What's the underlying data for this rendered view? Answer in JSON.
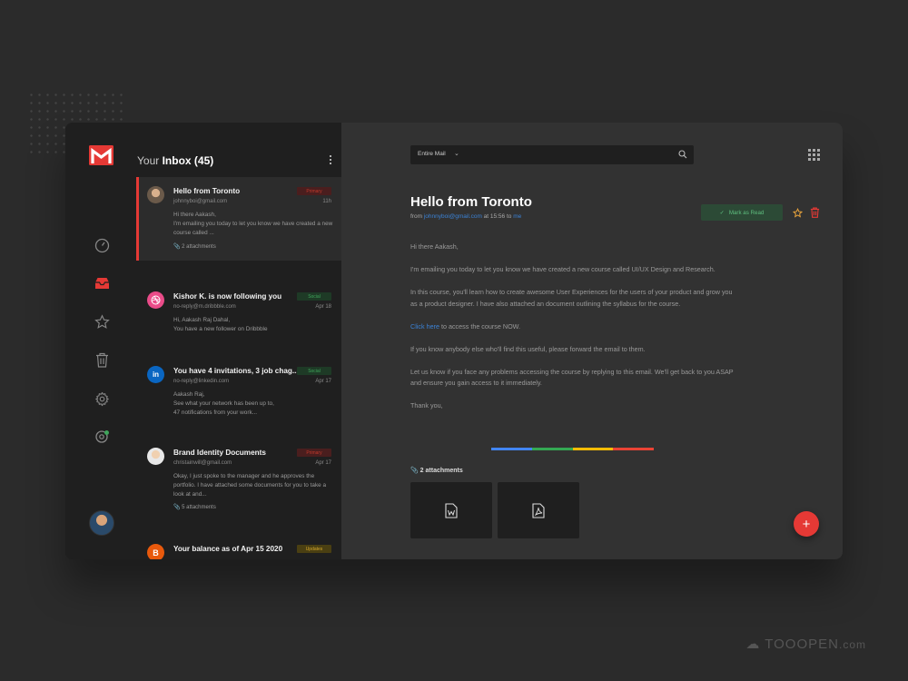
{
  "colors": {
    "accent_red": "#e53935",
    "link_blue": "#3b82d6",
    "success_green": "#5fbf7f"
  },
  "inbox": {
    "title_prefix": "Your",
    "title_main": "Inbox (45)",
    "mails": [
      {
        "subject": "Hello from Toronto",
        "from": "johnnyboi@gmail.com",
        "time": "11h",
        "badge": "Primary",
        "body": "Hi there Aakash,\nI'm emailing you today to let you know we have created a new course called ...",
        "attachments": "2 attachments",
        "avatar_icon": "person-avatar"
      },
      {
        "subject": "Kishor K. is now following you",
        "from": "no-reply@m.dribbble.com",
        "time": "Apr 18",
        "badge": "Social",
        "body": "Hi, Aakash Raj Dahal,\nYou have a new follower on Dribbble",
        "avatar_icon": "dribbble-icon"
      },
      {
        "subject": "You have 4 invitations, 3 job chag...",
        "from": "no-reply@linkedin.com",
        "time": "Apr 17",
        "badge": "Social",
        "body": "Aakash Raj,\nSee what your network has been up to,\n47 notifications from your work...",
        "avatar_icon": "linkedin-icon"
      },
      {
        "subject": "Brand Identity Documents",
        "from": "christainwill@gmail.com",
        "time": "Apr 17",
        "badge": "Primary",
        "body": "Okay, I just spoke to the manager and he approves the portfolio. I have attached some documents for you to take a look at and...",
        "attachments": "5 attachments",
        "avatar_icon": "person-avatar"
      },
      {
        "subject": "Your balance as of Apr 15 2020",
        "badge": "Updates",
        "avatar_letter": "B"
      }
    ]
  },
  "search": {
    "scope_label": "Entire Mail"
  },
  "email": {
    "subject": "Hello from Toronto",
    "from_prefix": "from",
    "from_address": "johnnyboi@gmail.com",
    "time_text": "at 15:56 to",
    "to": "me",
    "mark_read_label": "Mark as Read",
    "paragraphs": [
      "Hi there Aakash,",
      "I'm emailing you today to let you know we have created a new course called UI/UX Design and Research.",
      "In this course, you'll learn how to create awesome User Experiences for the users of your product and grow you as a product designer. I have also attached an document outlining the syllabus for the course."
    ],
    "link_text": "Click here",
    "link_suffix": " to access the course NOW.",
    "paragraphs_after": [
      "If you know anybody else who'll find this useful, please forward the email to them.",
      "Let us know if you face any problems accessing the course by replying to this email. We'll get back to you ASAP and ensure you gain access to it immediately.",
      "Thank you,"
    ],
    "attachments_label": "2 attachments",
    "attachment_icons": [
      "word-file-icon",
      "pdf-file-icon"
    ]
  },
  "fab_label": "+",
  "watermark": {
    "main": "TOOOPEN",
    "suffix": ".com"
  }
}
